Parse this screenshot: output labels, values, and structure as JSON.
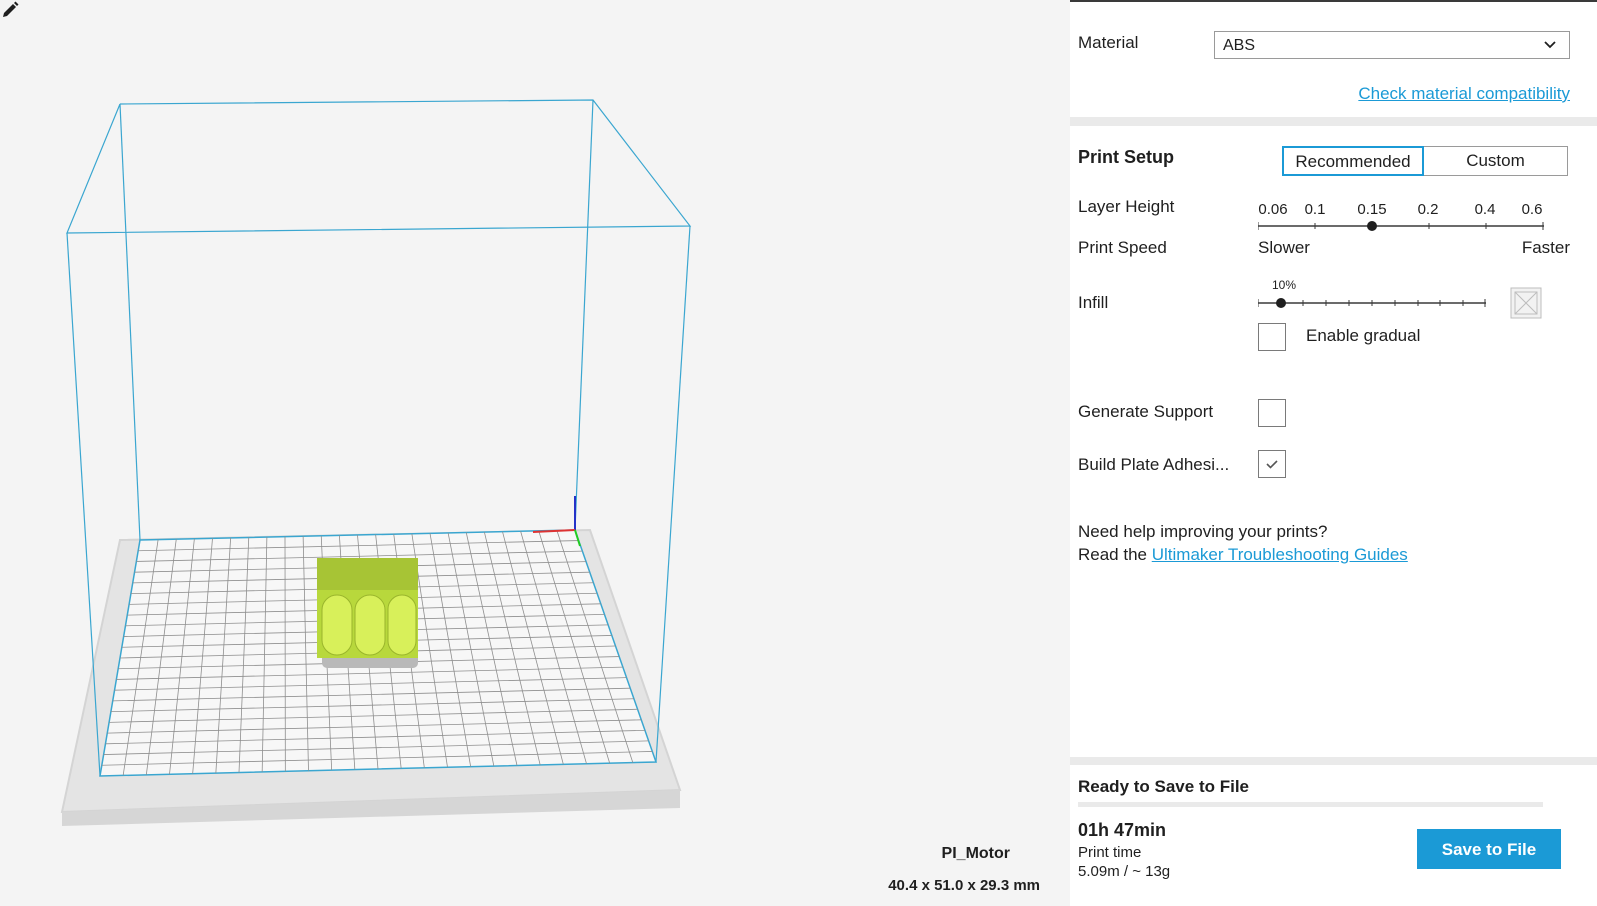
{
  "material": {
    "label": "Material",
    "selected": "ABS",
    "compat_link": "Check material compatibility"
  },
  "print_setup": {
    "title": "Print Setup",
    "tabs": [
      "Recommended",
      "Custom"
    ],
    "active_tab": "Recommended",
    "layer_height": {
      "label": "Layer Height",
      "ticks": [
        "0.06",
        "0.1",
        "0.15",
        "0.2",
        "0.4",
        "0.6"
      ],
      "selected": "0.15"
    },
    "print_speed": {
      "label": "Print Speed",
      "slower": "Slower",
      "faster": "Faster"
    },
    "infill": {
      "label": "Infill",
      "value": "10%",
      "gradual_label": "Enable gradual",
      "gradual_checked": false
    },
    "generate_support": {
      "label": "Generate Support",
      "checked": false
    },
    "adhesion": {
      "label": "Build Plate Adhesi...",
      "checked": true
    },
    "help": {
      "line1": "Need help improving your prints?",
      "line2_prefix": "Read the ",
      "link": "Ultimaker Troubleshooting Guides"
    }
  },
  "save": {
    "title": "Ready to Save to File",
    "time": "01h 47min",
    "time_label": "Print time",
    "material_usage": "5.09m / ~ 13g",
    "button": "Save to File"
  },
  "object": {
    "name": "PI_Motor",
    "dimensions": "40.4 x 51.0 x 29.3 mm"
  },
  "colors": {
    "accent": "#1b9ad6",
    "model": "#c8e84a",
    "volume_outline": "#3aa6d0"
  }
}
